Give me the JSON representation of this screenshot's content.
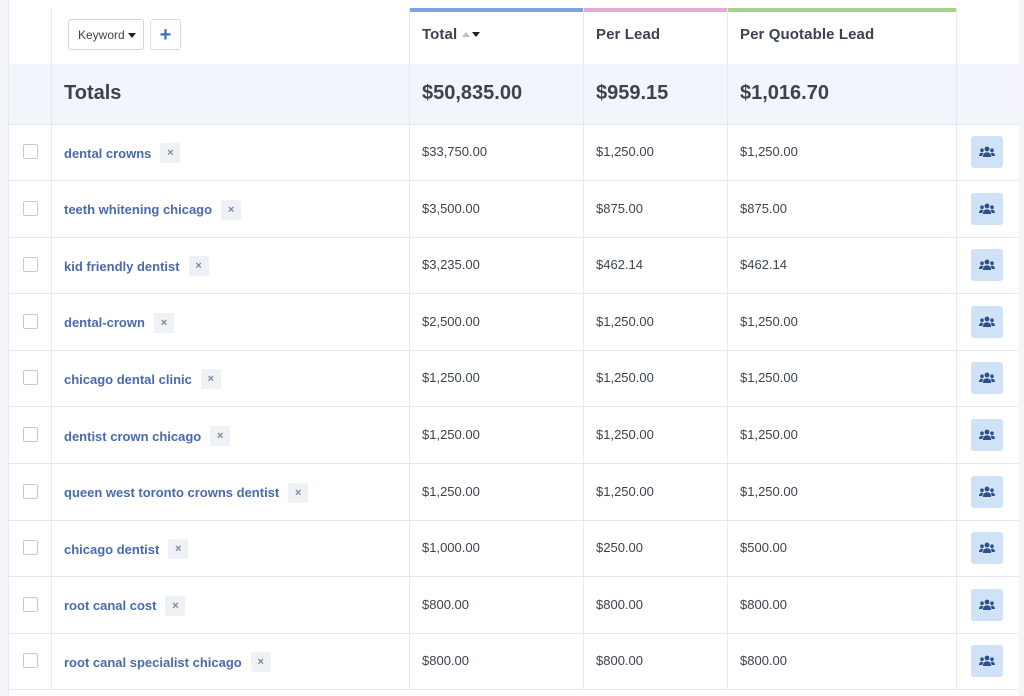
{
  "header": {
    "dimension_select": "Keyword",
    "add_label": "+",
    "columns": [
      {
        "label": "Total",
        "accent": "#7aa5dc"
      },
      {
        "label": "Per Lead",
        "accent": "#e8a8cf"
      },
      {
        "label": "Per Quotable Lead",
        "accent": "#a5d189"
      }
    ]
  },
  "totals": {
    "label": "Totals",
    "total": "$50,835.00",
    "per_lead": "$959.15",
    "per_quotable": "$1,016.70"
  },
  "remove_glyph": "×",
  "action_icon": "users-icon",
  "rows": [
    {
      "keyword": "dental crowns",
      "total": "$33,750.00",
      "per_lead": "$1,250.00",
      "per_quotable": "$1,250.00"
    },
    {
      "keyword": "teeth whitening chicago",
      "total": "$3,500.00",
      "per_lead": "$875.00",
      "per_quotable": "$875.00"
    },
    {
      "keyword": "kid friendly dentist",
      "total": "$3,235.00",
      "per_lead": "$462.14",
      "per_quotable": "$462.14"
    },
    {
      "keyword": "dental-crown",
      "total": "$2,500.00",
      "per_lead": "$1,250.00",
      "per_quotable": "$1,250.00"
    },
    {
      "keyword": "chicago dental clinic",
      "total": "$1,250.00",
      "per_lead": "$1,250.00",
      "per_quotable": "$1,250.00"
    },
    {
      "keyword": "dentist crown chicago",
      "total": "$1,250.00",
      "per_lead": "$1,250.00",
      "per_quotable": "$1,250.00"
    },
    {
      "keyword": "queen west toronto crowns dentist",
      "total": "$1,250.00",
      "per_lead": "$1,250.00",
      "per_quotable": "$1,250.00"
    },
    {
      "keyword": "chicago dentist",
      "total": "$1,000.00",
      "per_lead": "$250.00",
      "per_quotable": "$500.00"
    },
    {
      "keyword": "root canal cost",
      "total": "$800.00",
      "per_lead": "$800.00",
      "per_quotable": "$800.00"
    },
    {
      "keyword": "root canal specialist chicago",
      "total": "$800.00",
      "per_lead": "$800.00",
      "per_quotable": "$800.00"
    }
  ]
}
